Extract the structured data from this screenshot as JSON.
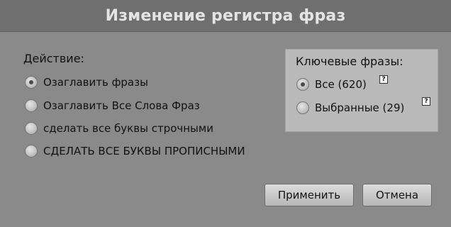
{
  "dialog": {
    "title": "Изменение регистра фраз"
  },
  "action": {
    "label": "Действие:",
    "options": [
      {
        "label": "Озаглавить фразы",
        "checked": true
      },
      {
        "label": "Озаглавить Все Слова Фраз",
        "checked": false
      },
      {
        "label": "сделать все буквы строчными",
        "checked": false
      },
      {
        "label": "СДЕЛАТЬ ВСЕ БУКВЫ ПРОПИСНЫМИ",
        "checked": false
      }
    ]
  },
  "keyphrases": {
    "label": "Ключевые фразы:",
    "options": [
      {
        "label": "Все (620)",
        "checked": true,
        "help": "?"
      },
      {
        "label": "Выбранные (29)",
        "checked": false,
        "help": "?"
      }
    ]
  },
  "buttons": {
    "apply": "Применить",
    "cancel": "Отмена"
  }
}
